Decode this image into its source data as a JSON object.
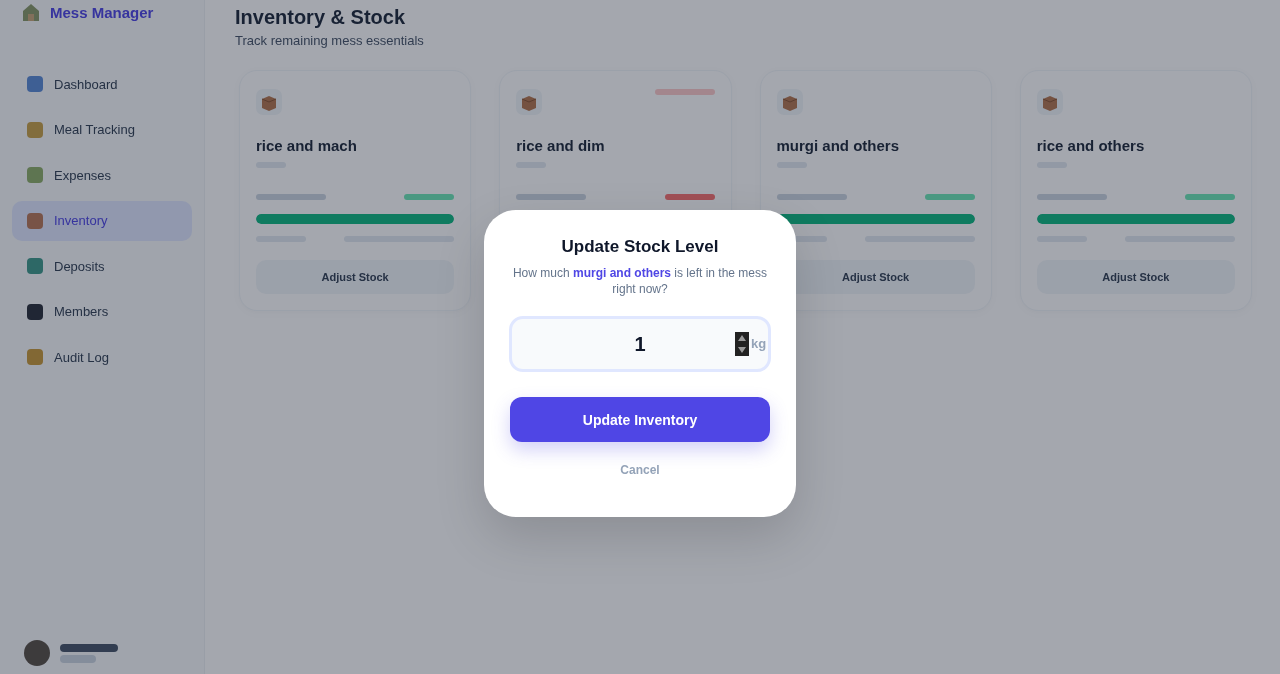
{
  "sidebar": {
    "brand": "Mess Manager",
    "items": [
      {
        "label": "Dashboard",
        "selected": false
      },
      {
        "label": "Meal Tracking",
        "selected": false
      },
      {
        "label": "Expenses",
        "selected": false
      },
      {
        "label": "Inventory",
        "selected": true
      },
      {
        "label": "Deposits",
        "selected": false
      },
      {
        "label": "Members",
        "selected": false
      },
      {
        "label": "Audit Log",
        "selected": false
      }
    ]
  },
  "header": {
    "title": "Inventory & Stock",
    "subtitle": "Track remaining mess essentials"
  },
  "cards": [
    {
      "name": "rice and mach",
      "low": false,
      "level": 1,
      "button": "Adjust Stock"
    },
    {
      "name": "rice and dim",
      "low": true
    },
    {
      "name": "murgi and others",
      "low": false,
      "level": 1,
      "button": "Adjust Stock"
    },
    {
      "name": "rice and others",
      "low": false,
      "level": 1,
      "button": "Adjust Stock"
    }
  ],
  "modal": {
    "title": "Update Stock Level",
    "question": "How much **murgi and others** is left in the mess right now?",
    "value": "1",
    "unit": "kg",
    "submit": "Update Inventory",
    "cancel": "Cancel"
  }
}
